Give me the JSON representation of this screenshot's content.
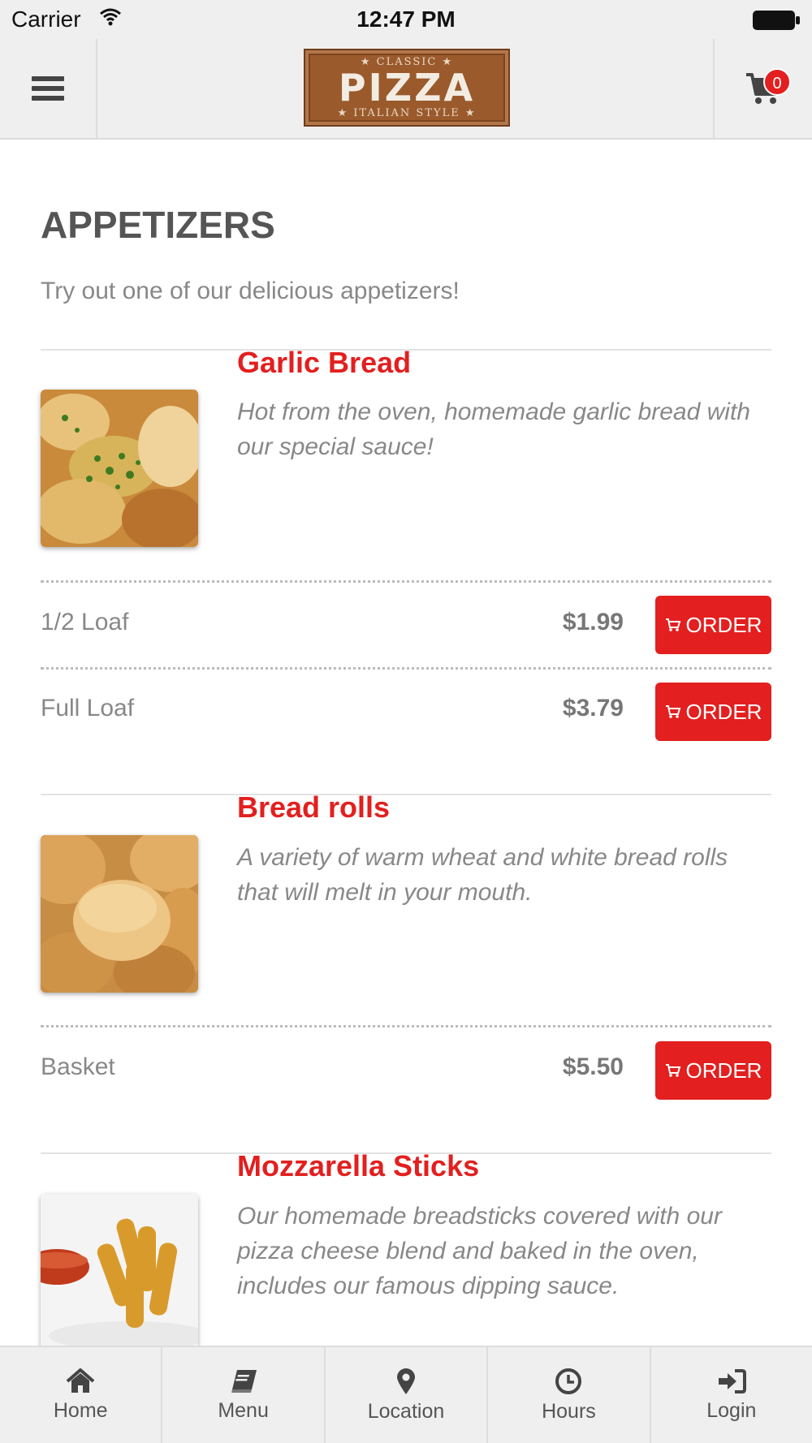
{
  "status_bar": {
    "carrier": "Carrier",
    "time": "12:47 PM"
  },
  "header": {
    "logo": {
      "top": "★ CLASSIC ★",
      "main": "PIZZA",
      "bottom": "★ ITALIAN STYLE ★"
    },
    "cart_count": "0"
  },
  "page": {
    "title": "APPETIZERS",
    "subtitle": "Try out one of our delicious appetizers!"
  },
  "items": [
    {
      "name": "Garlic Bread",
      "description": "Hot from the oven, homemade garlic bread with our special sauce!",
      "image_icon": "garlic-bread-image",
      "options": [
        {
          "size": "1/2 Loaf",
          "price": "$1.99",
          "button": "ORDER"
        },
        {
          "size": "Full Loaf",
          "price": "$3.79",
          "button": "ORDER"
        }
      ]
    },
    {
      "name": "Bread rolls",
      "description": "A variety of warm wheat and white bread rolls that will melt in your mouth.",
      "image_icon": "bread-rolls-image",
      "options": [
        {
          "size": "Basket",
          "price": "$5.50",
          "button": "ORDER"
        }
      ]
    },
    {
      "name": "Mozzarella Sticks",
      "description": "Our homemade breadsticks covered with our pizza cheese blend and baked in the oven, includes our famous dipping sauce.",
      "image_icon": "mozzarella-sticks-image",
      "options": []
    }
  ],
  "tabbar": [
    {
      "label": "Home",
      "icon": "home-icon"
    },
    {
      "label": "Menu",
      "icon": "book-icon"
    },
    {
      "label": "Location",
      "icon": "map-pin-icon"
    },
    {
      "label": "Hours",
      "icon": "clock-icon"
    },
    {
      "label": "Login",
      "icon": "login-icon"
    }
  ],
  "colors": {
    "accent": "#e31f1f",
    "bar_bg": "#efefef",
    "logo_brown": "#9a5a2c"
  }
}
